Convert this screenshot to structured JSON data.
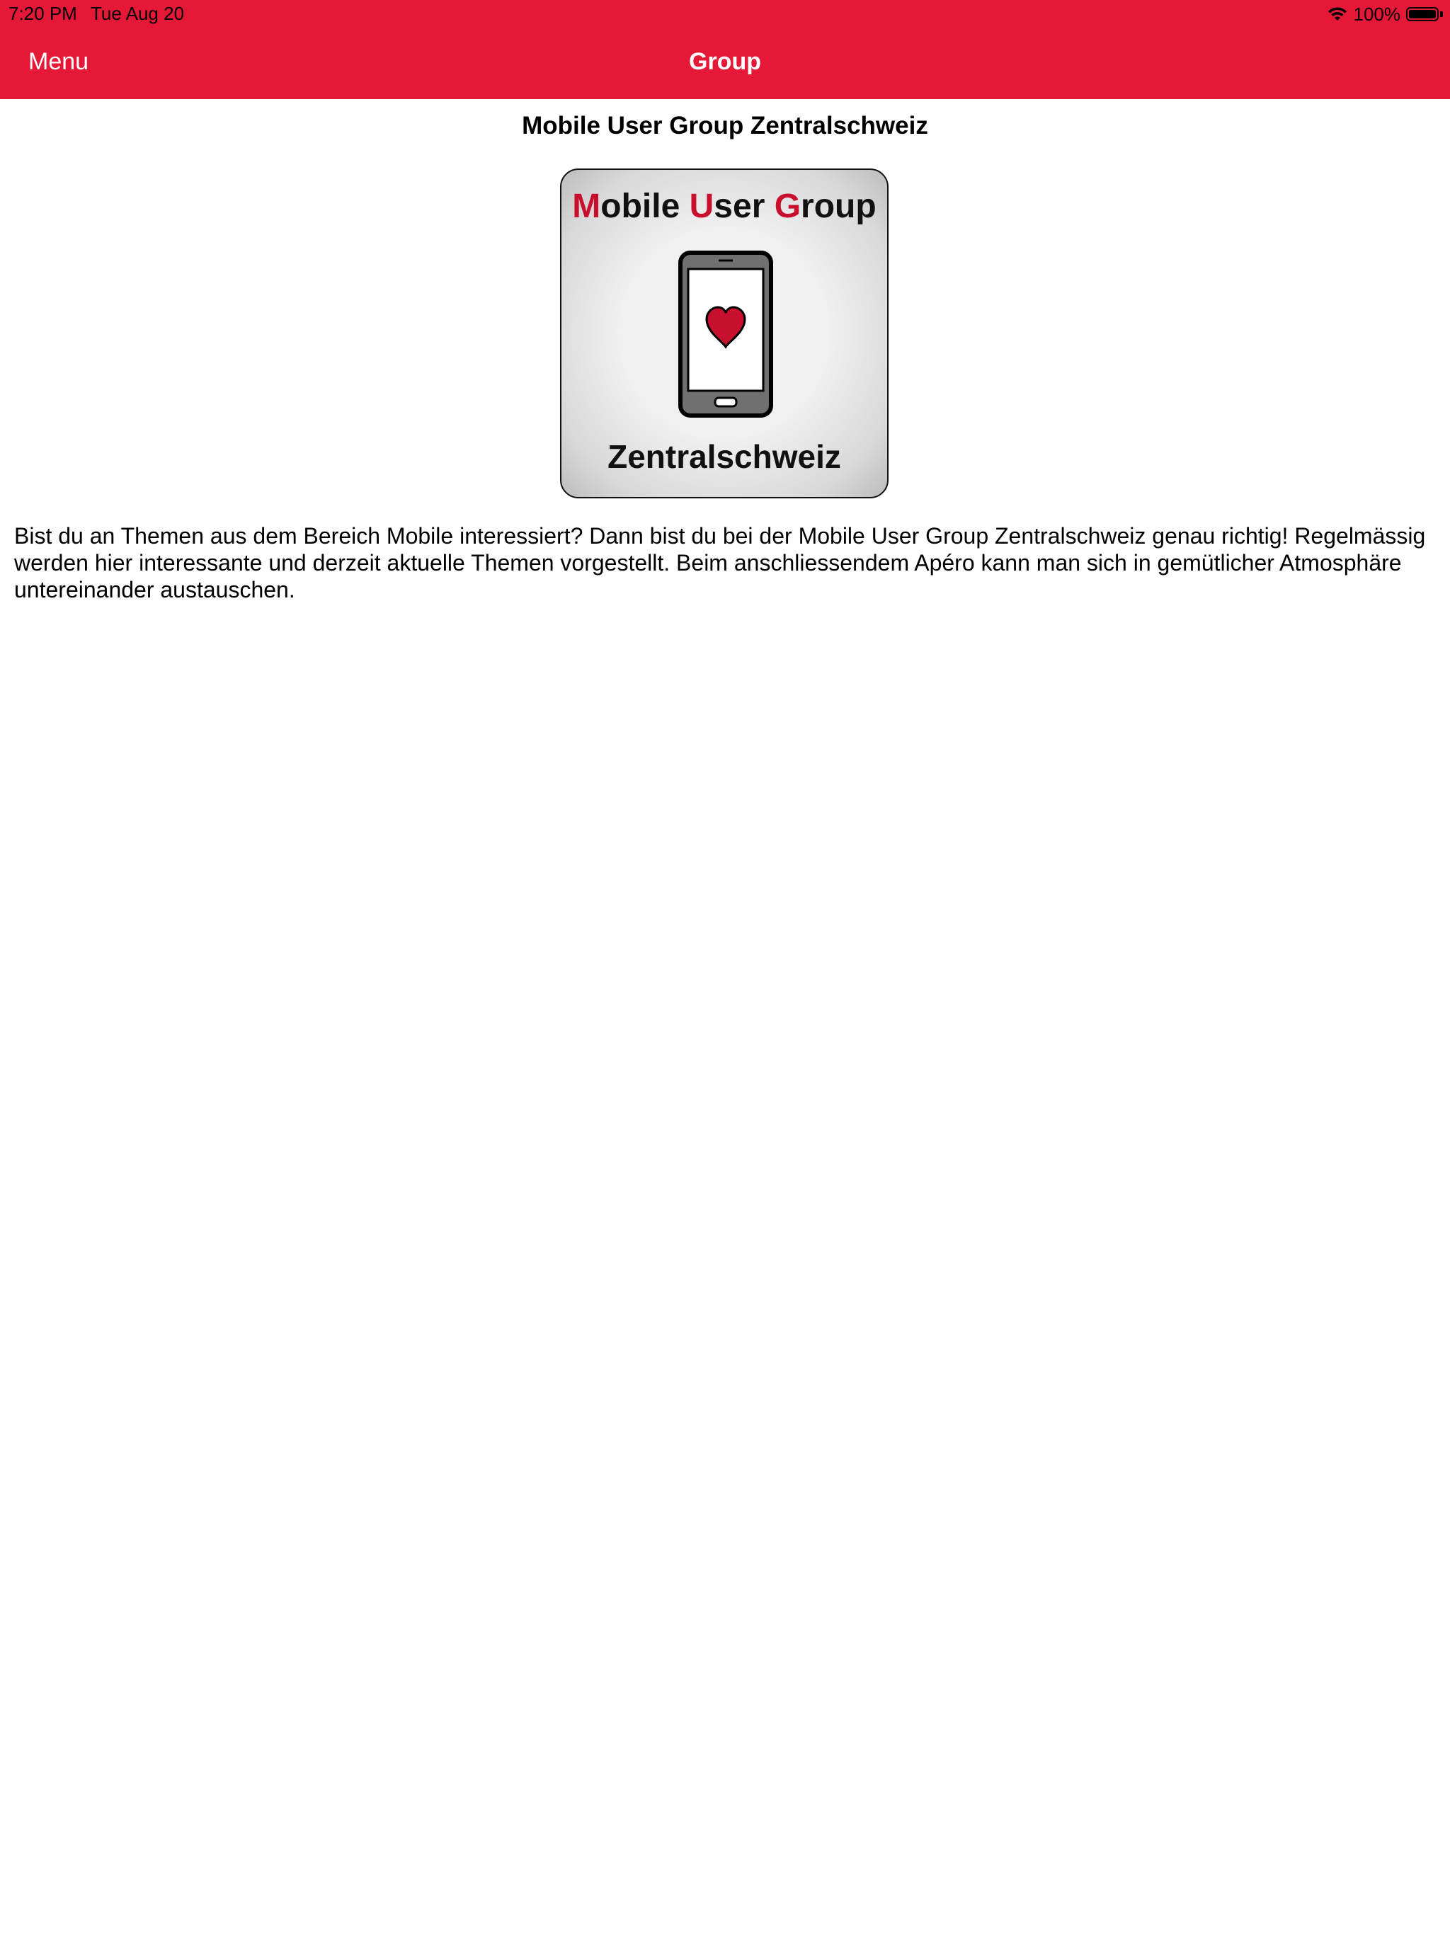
{
  "status_bar": {
    "time": "7:20 PM",
    "date": "Tue Aug 20",
    "battery": "100%",
    "battery_level": 1.0
  },
  "nav": {
    "menu_label": "Menu",
    "title": "Group"
  },
  "content": {
    "group_name": "Mobile User Group Zentralschweiz",
    "logo": {
      "line1": [
        "M",
        "obile ",
        "U",
        "ser ",
        "G",
        "roup"
      ],
      "line2": "Zentralschweiz"
    },
    "description": "Bist du an Themen aus dem Bereich Mobile interessiert? Dann bist du bei der Mobile User Group Zentralschweiz genau richtig! Regelmässig werden hier interessante und derzeit aktuelle Themen vorgestellt. Beim anschliessendem Apéro kann man sich in gemütlicher Atmosphäre untereinander austauschen."
  },
  "colors": {
    "brand_red": "#e51837",
    "logo_accent": "#c8102e"
  },
  "icons": [
    "wifi-icon",
    "battery-icon",
    "heart-icon",
    "phone-icon"
  ]
}
